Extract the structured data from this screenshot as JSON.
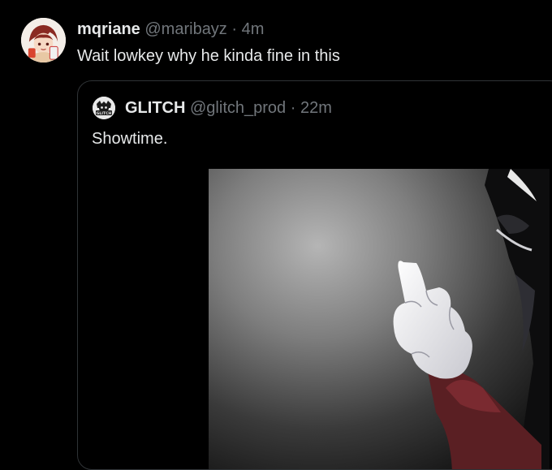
{
  "tweet": {
    "display_name": "mqriane",
    "handle": "@maribayz",
    "separator": "·",
    "time": "4m",
    "text": "Wait lowkey why he kinda fine in this"
  },
  "quote": {
    "display_name": "GLITCH",
    "handle": "@glitch_prod",
    "separator": "·",
    "time": "22m",
    "text": "Showtime.",
    "avatar_logo_text": "GLITCH"
  },
  "colors": {
    "background": "#000000",
    "primary_text": "#e7e9ea",
    "secondary_text": "#71767b",
    "border": "#2f3336"
  }
}
